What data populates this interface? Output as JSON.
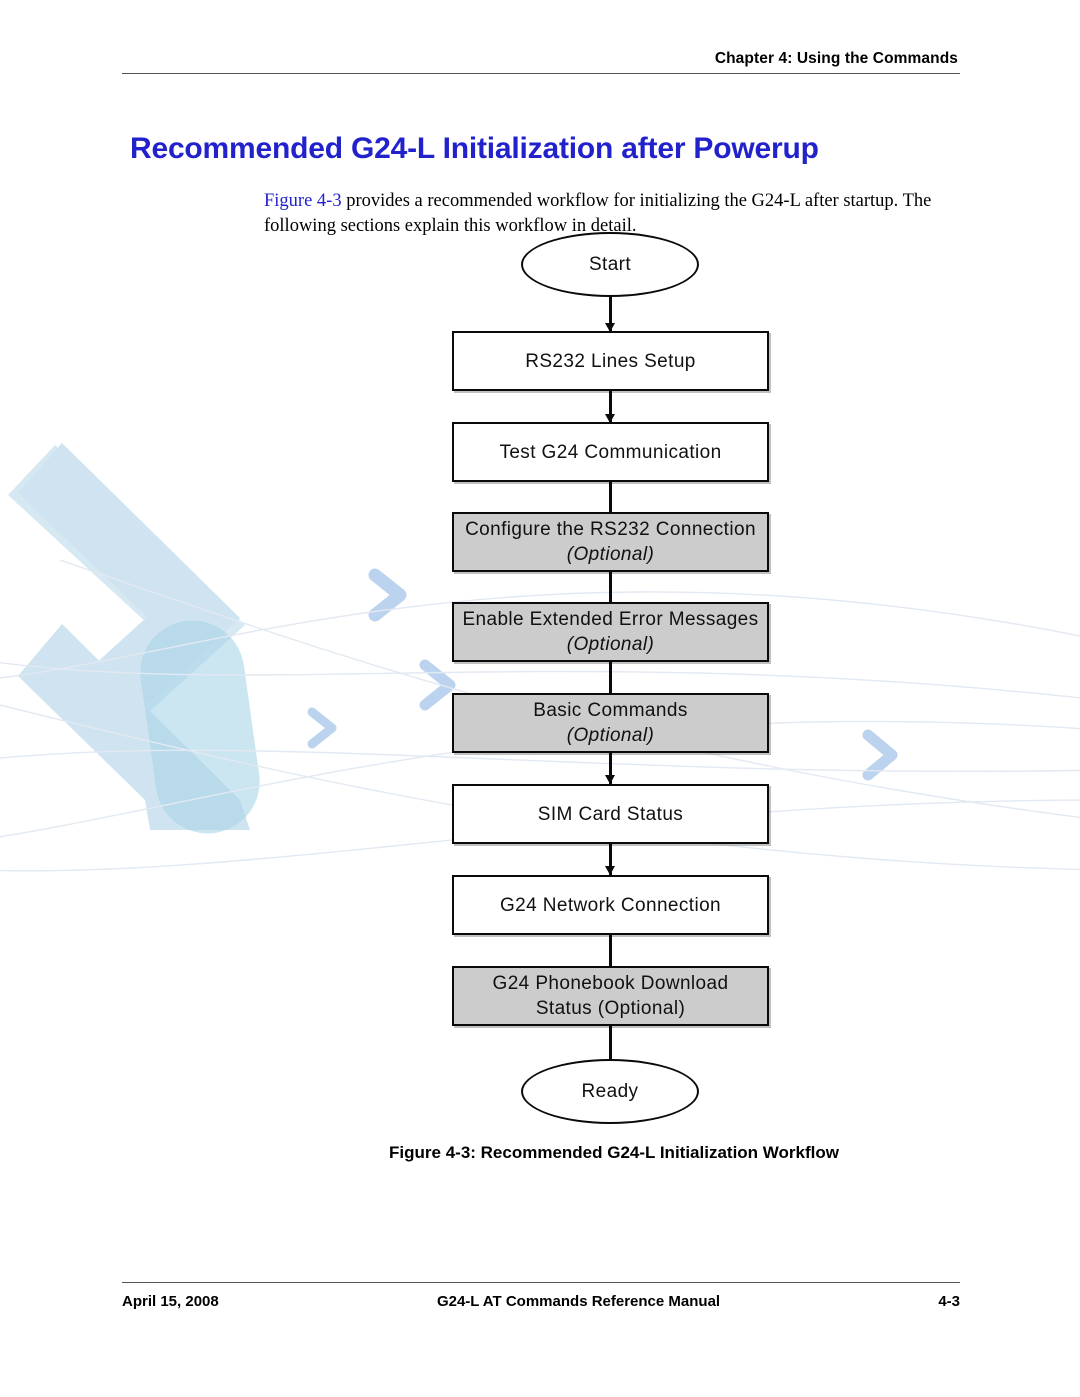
{
  "header": {
    "chapter": "Chapter 4:  Using the Commands"
  },
  "title": "Recommended G24-L Initialization after Powerup",
  "intro": {
    "xref": "Figure 4-3",
    "rest": " provides a recommended workflow for initializing the G24-L after startup. The following sections explain this workflow in detail."
  },
  "flowchart": {
    "nodes": [
      {
        "id": "start",
        "shape": "oval",
        "line1": "Start",
        "line2": "",
        "optional": false
      },
      {
        "id": "rs232-lines-setup",
        "shape": "box",
        "line1": "RS232 Lines Setup",
        "line2": "",
        "optional": false
      },
      {
        "id": "test-g24-comm",
        "shape": "box",
        "line1": "Test G24 Communication",
        "line2": "",
        "optional": false
      },
      {
        "id": "configure-rs232",
        "shape": "box",
        "line1": "Configure the RS232 Connection",
        "line2": "(Optional)",
        "optional": true
      },
      {
        "id": "enable-ext-errors",
        "shape": "box",
        "line1": "Enable Extended Error Messages",
        "line2": "(Optional)",
        "optional": true
      },
      {
        "id": "basic-commands",
        "shape": "box",
        "line1": "Basic Commands",
        "line2": "(Optional)",
        "optional": true
      },
      {
        "id": "sim-card-status",
        "shape": "box",
        "line1": "SIM Card Status",
        "line2": "",
        "optional": false
      },
      {
        "id": "g24-network-conn",
        "shape": "box",
        "line1": "G24 Network Connection",
        "line2": "",
        "optional": false
      },
      {
        "id": "g24-phonebook",
        "shape": "box",
        "line1": "G24 Phonebook Download",
        "line2": "Status (Optional)",
        "optional": true
      },
      {
        "id": "ready",
        "shape": "oval",
        "line1": "Ready",
        "line2": "",
        "optional": false
      }
    ]
  },
  "caption": "Figure 4-3: Recommended G24-L Initialization Workflow",
  "footer": {
    "date": "April 15, 2008",
    "manual": "G24-L AT Commands Reference Manual",
    "page": "4-3"
  },
  "colors": {
    "title_blue": "#2222CC",
    "xref_blue": "#2222CC",
    "optional_fill": "#CCCCCC",
    "node_stroke": "#0A0A0A",
    "watermark_blue": "#CFE4F0",
    "watermark_chevron": "#BBD3EE"
  }
}
